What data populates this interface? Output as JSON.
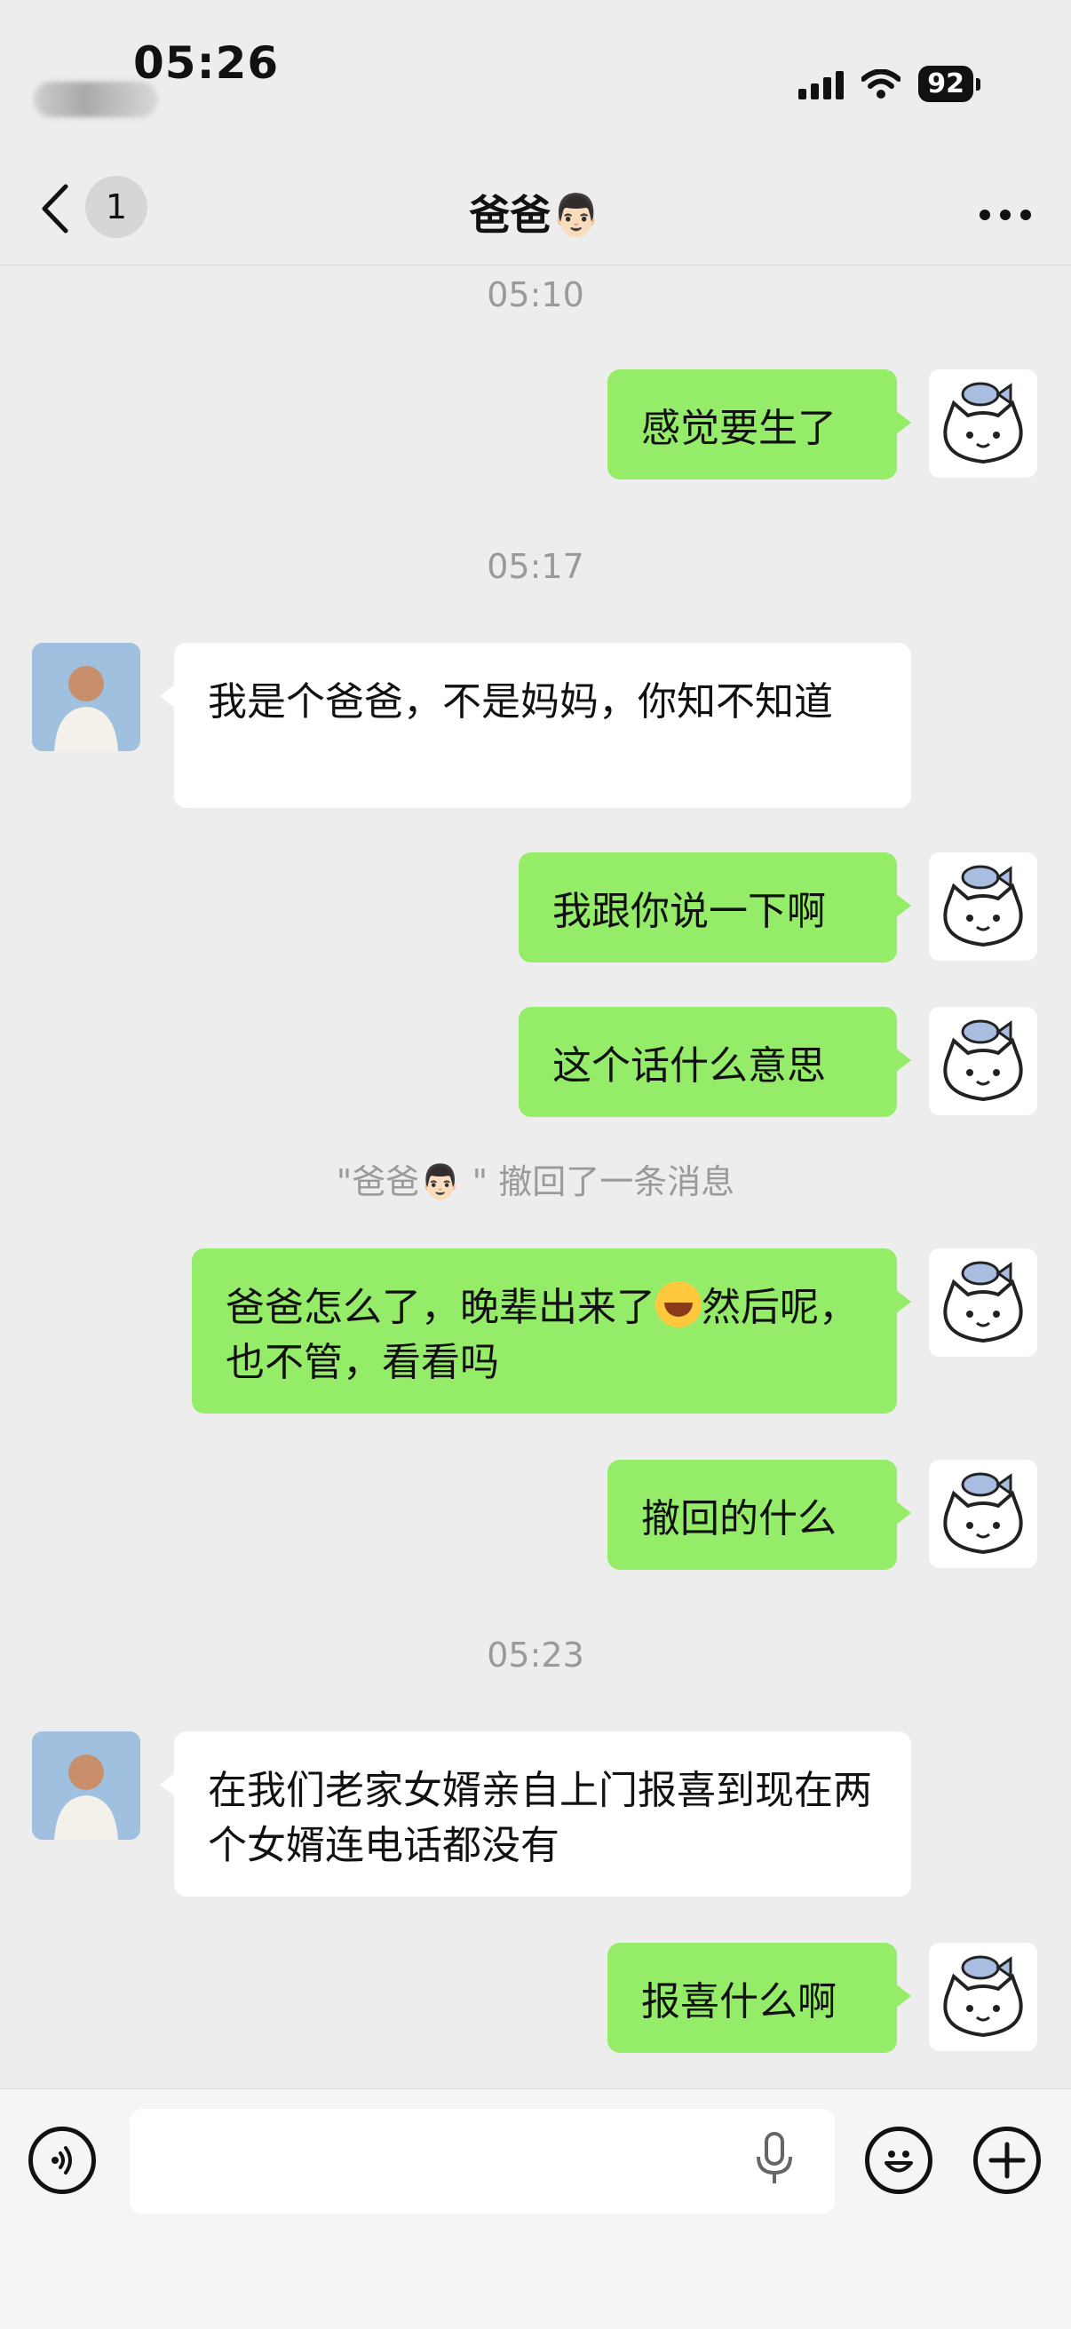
{
  "status_bar": {
    "time": "05:26",
    "battery": "92"
  },
  "nav": {
    "unread_count": "1",
    "title": "爸爸👨🏻"
  },
  "messages": [
    {
      "type": "timestamp",
      "text": "05:10"
    },
    {
      "type": "me",
      "text": "感觉要生了"
    },
    {
      "type": "timestamp",
      "text": "05:17"
    },
    {
      "type": "them",
      "text": "我是个爸爸，不是妈妈，你知不知道"
    },
    {
      "type": "me",
      "text": "我跟你说一下啊"
    },
    {
      "type": "me",
      "text": "这个话什么意思"
    },
    {
      "type": "system",
      "text": "\"爸爸👨🏻 \" 撤回了一条消息"
    },
    {
      "type": "me",
      "text_before": "爸爸怎么了，晚辈出来了",
      "emoji": "rolling-on-floor-laughing",
      "text_after": "然后呢，也不管，看看吗"
    },
    {
      "type": "me",
      "text": "撤回的什么"
    },
    {
      "type": "timestamp",
      "text": "05:23"
    },
    {
      "type": "them",
      "text": "在我们老家女婿亲自上门报喜到现在两个女婿连电话都没有"
    },
    {
      "type": "me",
      "text": "报喜什么啊"
    }
  ],
  "icons": {
    "back": "chevron-left-icon",
    "more": "more-dots-icon",
    "voice": "voice-mode-icon",
    "mic": "microphone-icon",
    "emoji": "emoji-icon",
    "plus": "plus-icon"
  },
  "colors": {
    "my_bubble": "#95ec69",
    "their_bubble": "#ffffff",
    "background": "#ededed"
  }
}
